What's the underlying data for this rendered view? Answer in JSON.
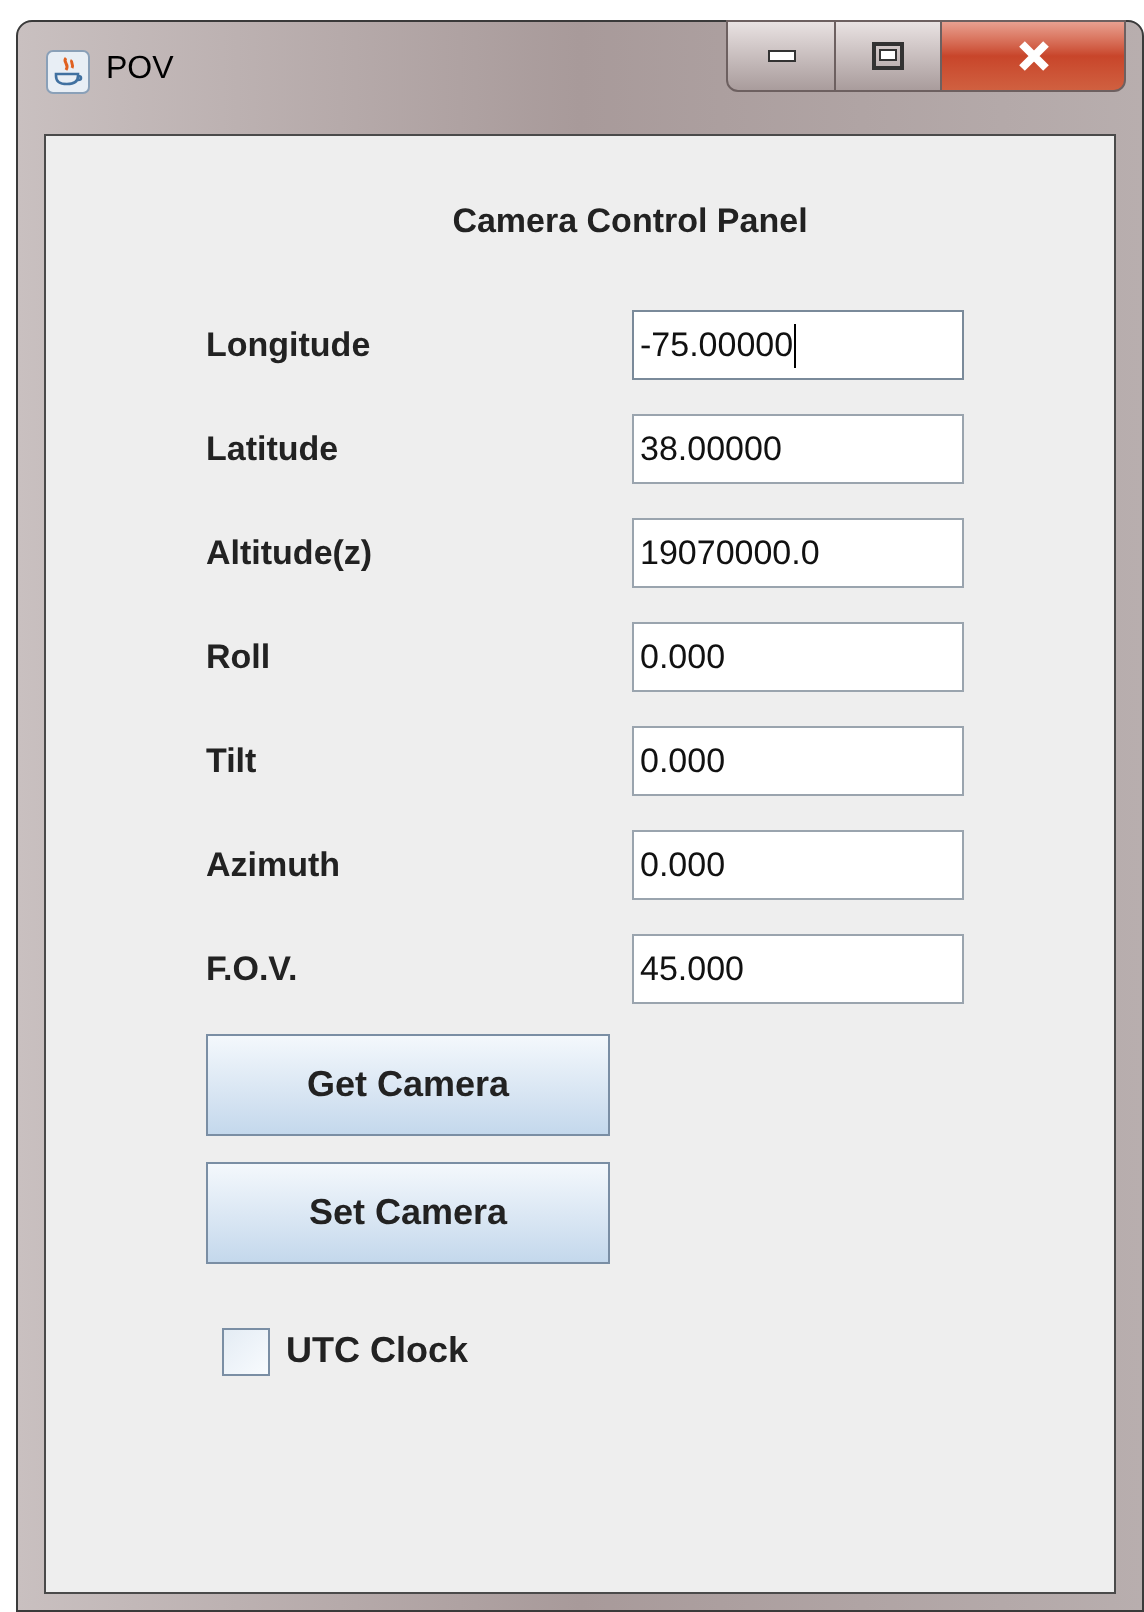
{
  "window": {
    "title": "POV"
  },
  "panel_title": "Camera Control Panel",
  "fields": [
    {
      "label": "Longitude",
      "value": "-75.00000",
      "focused": true
    },
    {
      "label": "Latitude",
      "value": "38.00000",
      "focused": false
    },
    {
      "label": "Altitude(z)",
      "value": "19070000.0",
      "focused": false
    },
    {
      "label": "Roll",
      "value": "0.000",
      "focused": false
    },
    {
      "label": "Tilt",
      "value": "0.000",
      "focused": false
    },
    {
      "label": "Azimuth",
      "value": "0.000",
      "focused": false
    },
    {
      "label": "F.O.V.",
      "value": "45.000",
      "focused": false
    }
  ],
  "buttons": [
    "Get Camera",
    "Set Camera"
  ],
  "checkbox": {
    "label": "UTC Clock",
    "checked": false
  }
}
